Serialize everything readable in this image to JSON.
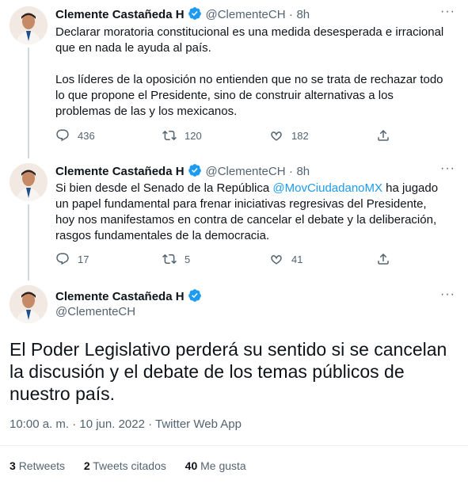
{
  "tweets": [
    {
      "name": "Clemente Castañeda H",
      "handle": "@ClementeCH",
      "time": "8h",
      "paragraphs": [
        "Declarar moratoria constitucional es una medida desesperada e irracional que en nada le ayuda al país.",
        "Los líderes de la oposición no entienden que no se trata de rechazar todo lo que propone el Presidente, sino de construir alternativas a los problemas de las y los mexicanos."
      ],
      "replies": "436",
      "retweets": "120",
      "likes": "182"
    },
    {
      "name": "Clemente Castañeda H",
      "handle": "@ClementeCH",
      "time": "8h",
      "text_before": "Si bien desde el Senado de la República ",
      "mention": "@MovCiudadanoMX",
      "text_after": " ha jugado un papel fundamental para frenar iniciativas regresivas del Presidente, hoy nos manifestamos en contra de cancelar el debate y la deliberación, rasgos fundamentales de la democracia.",
      "replies": "17",
      "retweets": "5",
      "likes": "41"
    }
  ],
  "main_tweet": {
    "name": "Clemente Castañeda H",
    "handle": "@ClementeCH",
    "text": "El Poder Legislativo perderá su sentido si se cancelan la discusión y el debate de los temas públicos de nuestro país.",
    "timestamp": "10:00 a. m. · 10 jun. 2022 · Twitter Web App",
    "retweets_count": "3",
    "retweets_label": "Retweets",
    "quotes_count": "2",
    "quotes_label": "Tweets citados",
    "likes_count": "40",
    "likes_label": "Me gusta"
  },
  "colors": {
    "accent": "#1d9bf0",
    "text": "#0f1419",
    "secondary": "#536471"
  },
  "icons": [
    "verified-badge-icon",
    "more-icon",
    "reply-icon",
    "retweet-icon",
    "like-icon",
    "share-icon"
  ]
}
